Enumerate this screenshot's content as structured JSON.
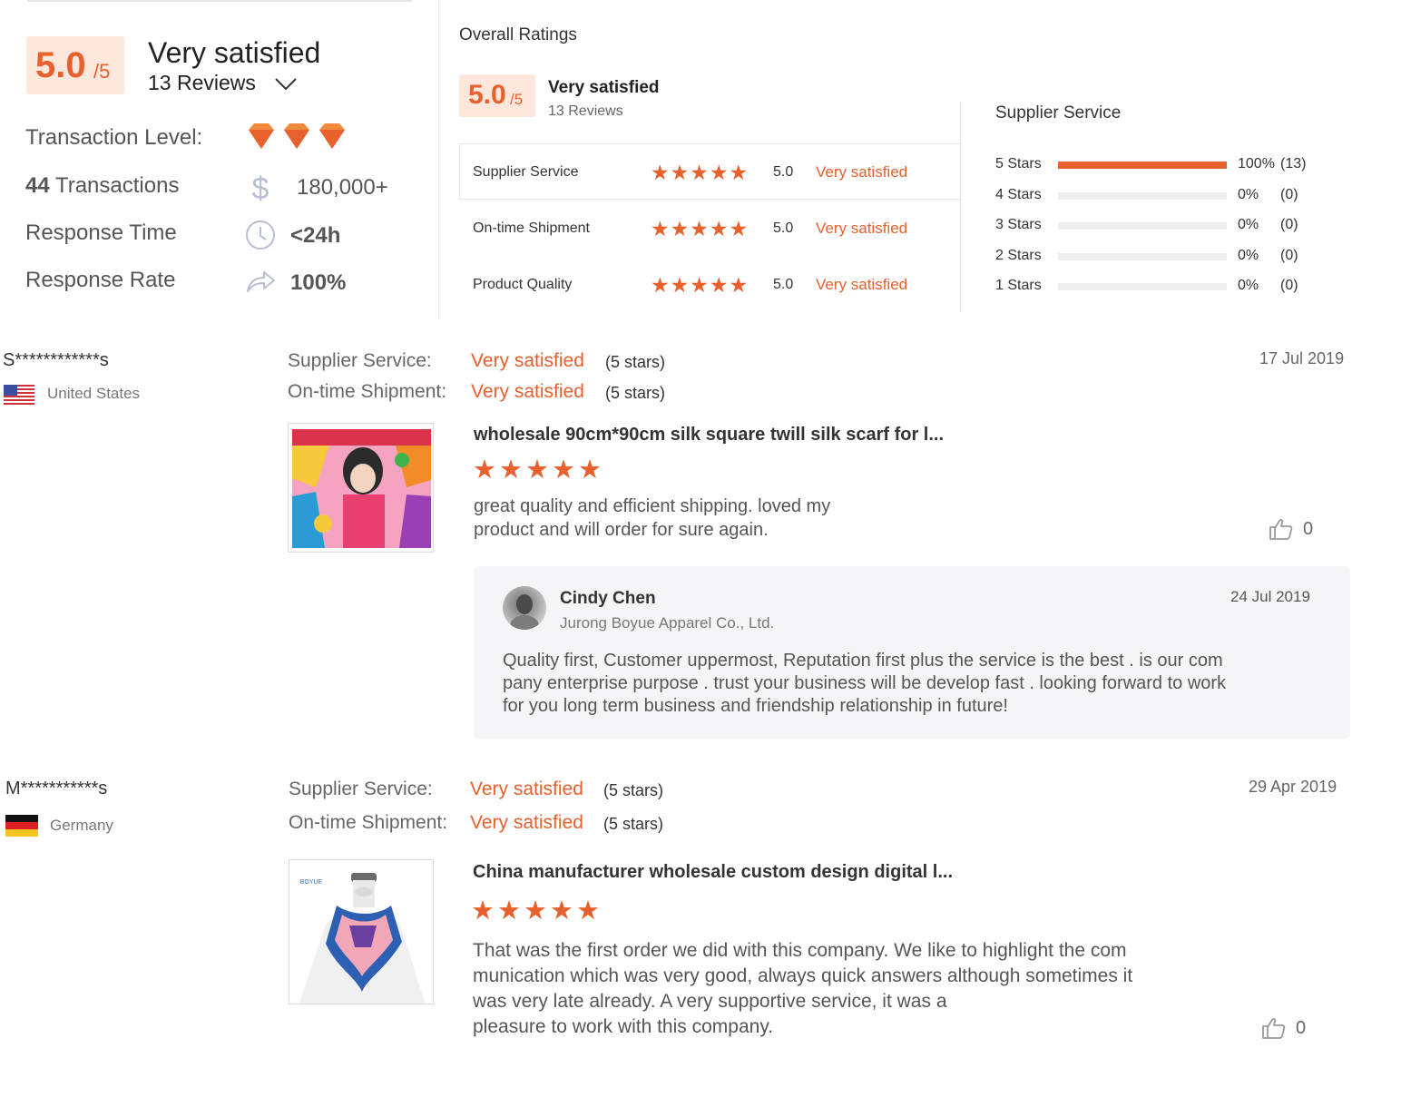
{
  "summary": {
    "score": "5.0",
    "score_suffix": "/5",
    "satisfaction": "Very satisfied",
    "reviews": "13 Reviews",
    "transaction_level_label": "Transaction Level:",
    "transaction_level_diamonds": 3,
    "transactions_count": "44",
    "transactions_label": " Transactions",
    "transactions_amount": "180,000+",
    "response_time_label": "Response Time",
    "response_time_value": "<24h",
    "response_rate_label": "Response Rate",
    "response_rate_value": "100%"
  },
  "overall": {
    "title": "Overall Ratings",
    "score": "5.0",
    "score_suffix": "/5",
    "satisfaction": "Very satisfied",
    "reviews": "13 Reviews",
    "rows": [
      {
        "label": "Supplier Service",
        "stars": "★★★★★",
        "score": "5.0",
        "satisfaction": "Very satisfied"
      },
      {
        "label": "On-time Shipment",
        "stars": "★★★★★",
        "score": "5.0",
        "satisfaction": "Very satisfied"
      },
      {
        "label": "Product Quality",
        "stars": "★★★★★",
        "score": "5.0",
        "satisfaction": "Very satisfied"
      }
    ]
  },
  "histogram": {
    "title": "Supplier Service",
    "rows": [
      {
        "label": "5  Stars",
        "fraction": 1.0,
        "pct": "100%",
        "count": "(13)"
      },
      {
        "label": "4  Stars",
        "fraction": 0.0,
        "pct": "0%",
        "count": "(0)"
      },
      {
        "label": "3  Stars",
        "fraction": 0.0,
        "pct": "0%",
        "count": "(0)"
      },
      {
        "label": "2  Stars",
        "fraction": 0.0,
        "pct": "0%",
        "count": "(0)"
      },
      {
        "label": "1  Stars",
        "fraction": 0.0,
        "pct": "0%",
        "count": "(0)"
      }
    ]
  },
  "reviews": [
    {
      "reviewer": "S************s",
      "country": "United States",
      "supplier_label": "Supplier Service:",
      "supplier_sat": "Very satisfied",
      "supplier_stars": "(5 stars)",
      "shipment_label": "On-time Shipment:",
      "shipment_sat": "Very satisfied",
      "shipment_stars": "(5 stars)",
      "date": "17 Jul 2019",
      "product_title": "wholesale 90cm*90cm silk square twill silk scarf for l...",
      "stars": "★★★★★",
      "text_line1": "great quality and efficient shipping. loved my",
      "text_line2": "product and will order for sure again.",
      "likes": "0",
      "reply": {
        "name": "Cindy Chen",
        "company": "Jurong Boyue Apparel Co., Ltd.",
        "date": "24 Jul 2019",
        "text_line1": "Quality first, Customer uppermost, Reputation first plus the service is the best . is our com",
        "text_line2": "pany enterprise purpose . trust your business will be develop fast . looking forward to work",
        "text_line3": "for you long term business and friendship relationship in future!"
      }
    },
    {
      "reviewer": "M***********s",
      "country": "Germany",
      "supplier_label": "Supplier Service:",
      "supplier_sat": "Very satisfied",
      "supplier_stars": "(5 stars)",
      "shipment_label": "On-time Shipment:",
      "shipment_sat": "Very satisfied",
      "shipment_stars": "(5 stars)",
      "date": "29 Apr 2019",
      "product_title": "China manufacturer wholesale custom design digital l...",
      "stars": "★★★★★",
      "text_line1": "That was the first order we did with this company. We like to highlight the com",
      "text_line2": "munication which was very good, always quick answers although sometimes it",
      "text_line3": "was very late already. A very supportive service, it was a",
      "text_line4": "pleasure to work with this company.",
      "likes": "0",
      "brand_mark": "BOYUE"
    }
  ],
  "colors": {
    "accent": "#e8602c",
    "accent_bg": "#fde7dc"
  },
  "icons": [
    "diamond-icon",
    "dollar-icon",
    "clock-icon",
    "share-arrow-icon",
    "thumbs-up-icon",
    "chevron-down-icon",
    "us-flag-icon",
    "germany-flag-icon"
  ]
}
